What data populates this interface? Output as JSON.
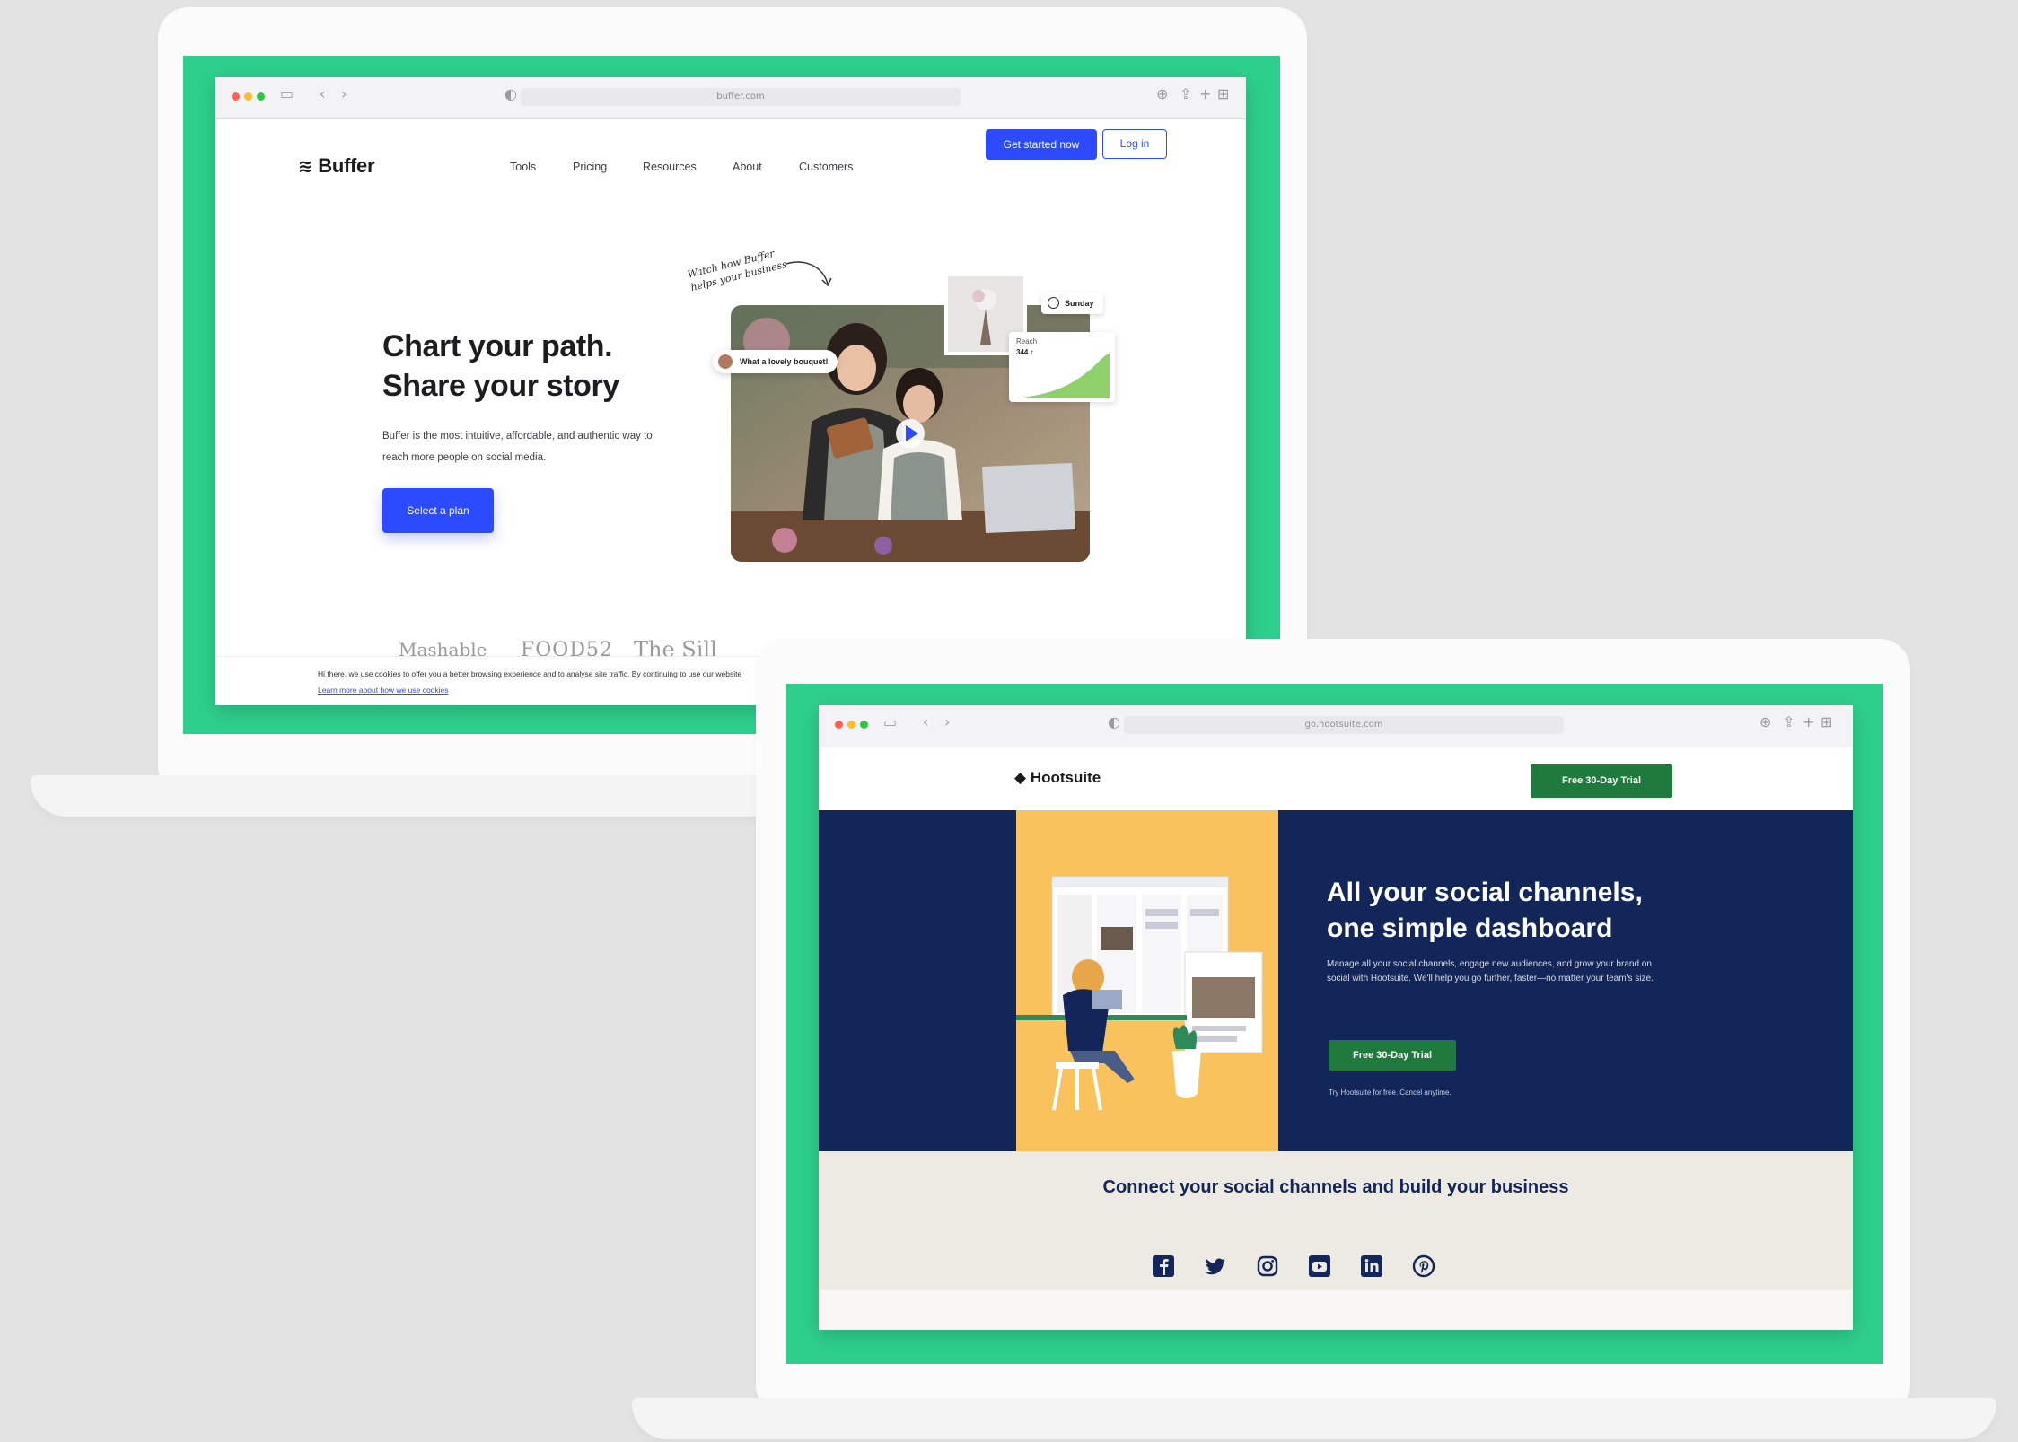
{
  "buffer": {
    "url": "buffer.com",
    "logo": "Buffer",
    "nav": [
      "Tools",
      "Pricing",
      "Resources",
      "About",
      "Customers"
    ],
    "get_started": "Get started now",
    "login": "Log in",
    "hero_line1": "Chart your path.",
    "hero_line2": "Share your story",
    "hero_sub": "Buffer is the most intuitive, affordable, and authentic way to reach more people on social media.",
    "cta": "Select a plan",
    "handwritten": "Watch how Buffer helps your business",
    "comment_bubble": "What a lovely bouquet!",
    "schedule_label": "Sunday",
    "reach_label": "Reach",
    "reach_value": "344 ↑",
    "press": [
      "Mashable",
      "FOOD52",
      "The Sill"
    ],
    "cookie_text": "Hi there, we use cookies to offer you a better browsing experience and to analyse site traffic. By continuing to use our website",
    "cookie_link": "Learn more about how we use cookies"
  },
  "hootsuite": {
    "url": "go.hootsuite.com",
    "logo": "Hootsuite",
    "header_cta": "Free 30-Day Trial",
    "title_line1": "All your social channels,",
    "title_line2": "one simple dashboard",
    "body": "Manage all your social channels, engage new audiences, and grow your brand on social with Hootsuite. We'll help you go further, faster—no matter your team's size.",
    "hero_cta": "Free 30-Day Trial",
    "fine_print": "Try Hootsuite for free. Cancel anytime.",
    "connect_title": "Connect your social channels and build your business",
    "social_icons": [
      "facebook-icon",
      "twitter-icon",
      "instagram-icon",
      "youtube-icon",
      "linkedin-icon",
      "pinterest-icon"
    ]
  },
  "colors": {
    "background": "#e3e3e3",
    "frame_green": "#2ecf8c",
    "buffer_blue": "#2c4bff",
    "hootsuite_navy": "#13265a",
    "hootsuite_yellow": "#f9c25c",
    "hootsuite_green": "#1f7a3d",
    "hootsuite_sand": "#ede9e3"
  }
}
